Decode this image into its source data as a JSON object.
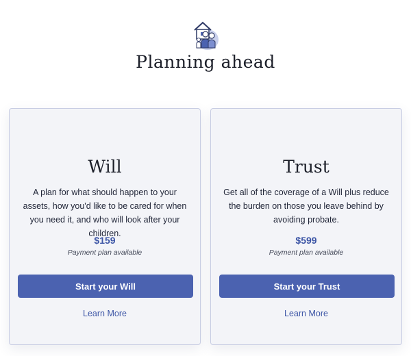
{
  "header": {
    "title": "Planning ahead",
    "illustration": "family-house-icon"
  },
  "cards": [
    {
      "title": "Will",
      "description": "A plan for what should happen to your assets, how you'd like to be cared for when you need it, and who will look after your children.",
      "price": "$159",
      "payment_note": "Payment plan available",
      "button_label": "Start your Will",
      "link_label": "Learn More"
    },
    {
      "title": "Trust",
      "description": "Get all of the coverage of a Will plus reduce the burden on those you leave behind by avoiding probate.",
      "price": "$599",
      "payment_note": "Payment plan available",
      "button_label": "Start your Trust",
      "link_label": "Learn More"
    }
  ],
  "colors": {
    "accent": "#4b62b0",
    "price_text": "#3d56a6",
    "card_background": "#f3f4f8",
    "card_border": "#c8cde3"
  }
}
